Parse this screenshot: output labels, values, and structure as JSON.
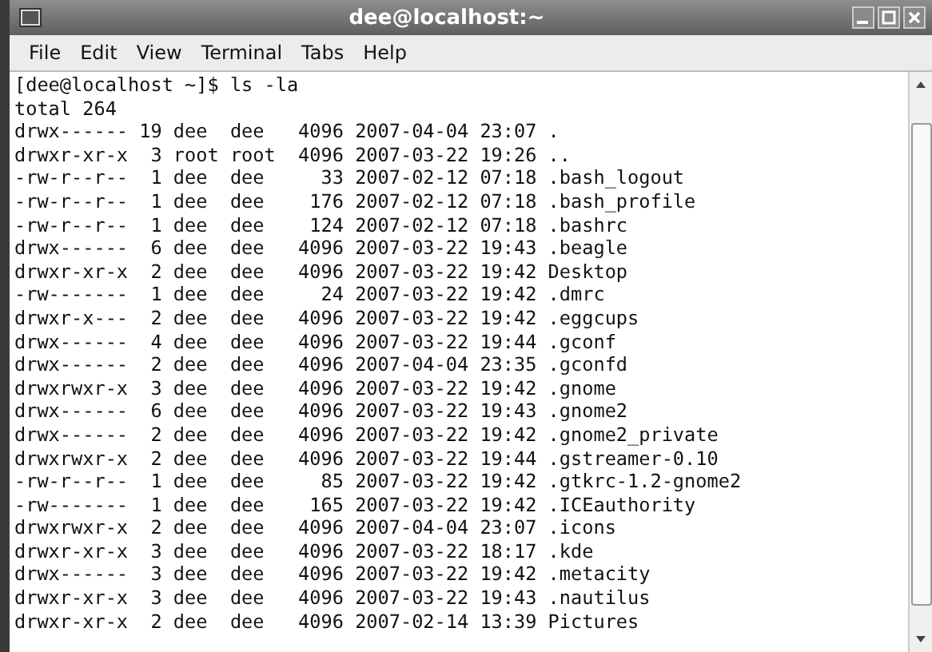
{
  "window": {
    "title": "dee@localhost:~"
  },
  "menu": [
    {
      "label": "File"
    },
    {
      "label": "Edit"
    },
    {
      "label": "View"
    },
    {
      "label": "Terminal"
    },
    {
      "label": "Tabs"
    },
    {
      "label": "Help"
    }
  ],
  "terminal": {
    "lines": [
      "[dee@localhost ~]$ ls -la",
      "total 264",
      "drwx------ 19 dee  dee   4096 2007-04-04 23:07 .",
      "drwxr-xr-x  3 root root  4096 2007-03-22 19:26 ..",
      "-rw-r--r--  1 dee  dee     33 2007-02-12 07:18 .bash_logout",
      "-rw-r--r--  1 dee  dee    176 2007-02-12 07:18 .bash_profile",
      "-rw-r--r--  1 dee  dee    124 2007-02-12 07:18 .bashrc",
      "drwx------  6 dee  dee   4096 2007-03-22 19:43 .beagle",
      "drwxr-xr-x  2 dee  dee   4096 2007-03-22 19:42 Desktop",
      "-rw-------  1 dee  dee     24 2007-03-22 19:42 .dmrc",
      "drwxr-x---  2 dee  dee   4096 2007-03-22 19:42 .eggcups",
      "drwx------  4 dee  dee   4096 2007-03-22 19:44 .gconf",
      "drwx------  2 dee  dee   4096 2007-04-04 23:35 .gconfd",
      "drwxrwxr-x  3 dee  dee   4096 2007-03-22 19:42 .gnome",
      "drwx------  6 dee  dee   4096 2007-03-22 19:43 .gnome2",
      "drwx------  2 dee  dee   4096 2007-03-22 19:42 .gnome2_private",
      "drwxrwxr-x  2 dee  dee   4096 2007-03-22 19:44 .gstreamer-0.10",
      "-rw-r--r--  1 dee  dee     85 2007-03-22 19:42 .gtkrc-1.2-gnome2",
      "-rw-------  1 dee  dee    165 2007-03-22 19:42 .ICEauthority",
      "drwxrwxr-x  2 dee  dee   4096 2007-04-04 23:07 .icons",
      "drwxr-xr-x  3 dee  dee   4096 2007-03-22 18:17 .kde",
      "drwx------  3 dee  dee   4096 2007-03-22 19:42 .metacity",
      "drwxr-xr-x  3 dee  dee   4096 2007-03-22 19:43 .nautilus",
      "drwxr-xr-x  2 dee  dee   4096 2007-02-14 13:39 Pictures"
    ]
  }
}
